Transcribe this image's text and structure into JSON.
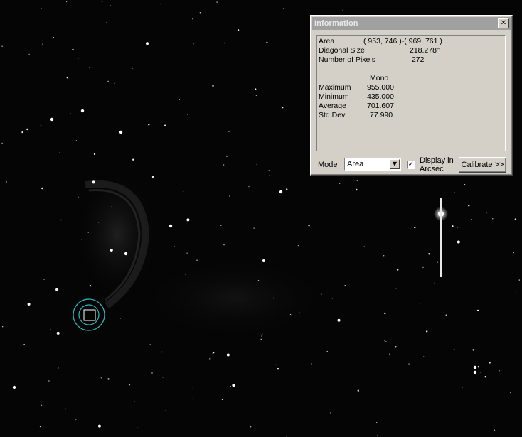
{
  "window": {
    "title": "Information",
    "close_glyph": "✕"
  },
  "info": {
    "area_label": "Area",
    "area_value": "( 953, 746 )-( 969, 761 )",
    "diag_label": "Diagonal Size",
    "diag_value": "218.278''",
    "pixels_label": "Number of Pixels",
    "pixels_value": "272",
    "channel_header": "Mono",
    "max_label": "Maximum",
    "max_value": "955.000",
    "min_label": "Minimum",
    "min_value": "435.000",
    "avg_label": "Average",
    "avg_value": "701.607",
    "std_label": "Std Dev",
    "std_value": "77.990"
  },
  "controls": {
    "mode_label": "Mode",
    "mode_value": "Area",
    "dropdown_glyph": "▼",
    "check_glyph": "✓",
    "display_arcsec_label": "Display in Arcsec",
    "display_arcsec_checked": true,
    "calibrate_label": "Calibrate >>"
  },
  "colors": {
    "sky_background": "#050505",
    "aperture_ring": "#2fb7c0",
    "title_bar": "#a0a0a0",
    "dialog_face": "#d4d0c8"
  },
  "icons": {
    "close": "close-icon",
    "dropdown": "chevron-down-icon",
    "check": "check-icon"
  }
}
